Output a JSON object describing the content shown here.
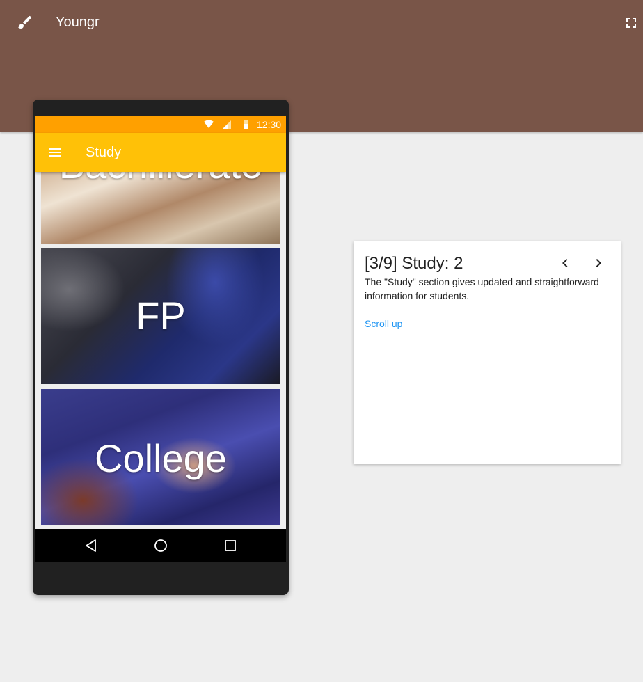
{
  "topbar": {
    "title": "Youngr",
    "brush_icon": "brush-icon",
    "fullscreen_icon": "fullscreen-icon",
    "color": "#795548"
  },
  "phone": {
    "status_bar": {
      "time": "12:30",
      "icons": [
        "wifi-icon",
        "signal-icon",
        "battery-icon"
      ],
      "color": "#ffa000"
    },
    "app_bar": {
      "title": "Study",
      "menu_icon": "menu-icon",
      "color": "#ffc107"
    },
    "cards": [
      {
        "label": "Bachillerato"
      },
      {
        "label": "FP"
      },
      {
        "label": "College"
      }
    ],
    "nav_bar": [
      "back-icon",
      "home-icon",
      "recents-icon"
    ]
  },
  "tour": {
    "title": "[3/9] Study: 2",
    "body": "The \"Study\" section gives updated and straightforward information for students.",
    "link": "Scroll up",
    "link_color": "#2196f3",
    "prev_icon": "chevron-left-icon",
    "next_icon": "chevron-right-icon"
  }
}
